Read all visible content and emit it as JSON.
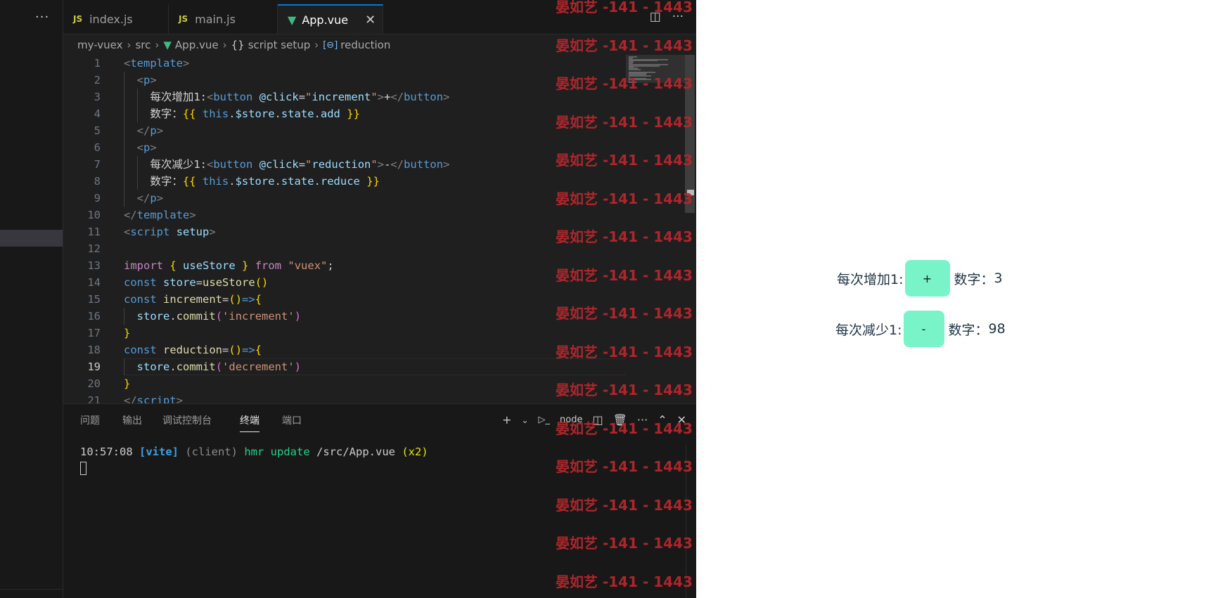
{
  "sidebar": {
    "more_label": "···"
  },
  "tabs": [
    {
      "label": "index.js",
      "icon": "js-icon",
      "icon_text": "JS"
    },
    {
      "label": "main.js",
      "icon": "js-icon",
      "icon_text": "JS"
    },
    {
      "label": "App.vue",
      "icon": "vue-icon",
      "close": "✕"
    }
  ],
  "breadcrumb": {
    "items": [
      "my-vuex",
      "src",
      "App.vue",
      "script setup",
      "reduction"
    ],
    "brace": "{}",
    "var_icon": "[⊖]"
  },
  "code": {
    "current_line": 19,
    "lines": [
      [
        [
          "t-punc",
          "<"
        ],
        [
          "t-tag",
          "template"
        ],
        [
          "t-punc",
          ">"
        ]
      ],
      [
        [
          "t-plain",
          "  "
        ],
        [
          "t-punc",
          "<"
        ],
        [
          "t-tag",
          "p"
        ],
        [
          "t-punc",
          ">"
        ]
      ],
      [
        [
          "t-plain",
          "    "
        ],
        [
          "t-text",
          "每次增加1:"
        ],
        [
          "t-punc",
          "<"
        ],
        [
          "t-tag",
          "button"
        ],
        [
          "t-plain",
          " "
        ],
        [
          "t-attr",
          "@click"
        ],
        [
          "t-text",
          "="
        ],
        [
          "t-str",
          "\""
        ],
        [
          "t-var",
          "increment"
        ],
        [
          "t-str",
          "\""
        ],
        [
          "t-punc",
          ">"
        ],
        [
          "t-text",
          "+"
        ],
        [
          "t-punc",
          "</"
        ],
        [
          "t-tag",
          "button"
        ],
        [
          "t-punc",
          ">"
        ]
      ],
      [
        [
          "t-plain",
          "    "
        ],
        [
          "t-text",
          "数字："
        ],
        [
          "t-br1",
          "{{"
        ],
        [
          "t-plain",
          " "
        ],
        [
          "t-kw",
          "this"
        ],
        [
          "t-plain",
          "."
        ],
        [
          "t-var",
          "$store"
        ],
        [
          "t-plain",
          "."
        ],
        [
          "t-var",
          "state"
        ],
        [
          "t-plain",
          "."
        ],
        [
          "t-var",
          "add"
        ],
        [
          "t-plain",
          " "
        ],
        [
          "t-br1",
          "}}"
        ]
      ],
      [
        [
          "t-plain",
          "  "
        ],
        [
          "t-punc",
          "</"
        ],
        [
          "t-tag",
          "p"
        ],
        [
          "t-punc",
          ">"
        ]
      ],
      [
        [
          "t-plain",
          "  "
        ],
        [
          "t-punc",
          "<"
        ],
        [
          "t-tag",
          "p"
        ],
        [
          "t-punc",
          ">"
        ]
      ],
      [
        [
          "t-plain",
          "    "
        ],
        [
          "t-text",
          "每次减少1:"
        ],
        [
          "t-punc",
          "<"
        ],
        [
          "t-tag",
          "button"
        ],
        [
          "t-plain",
          " "
        ],
        [
          "t-attr",
          "@click"
        ],
        [
          "t-text",
          "="
        ],
        [
          "t-str",
          "\""
        ],
        [
          "t-var",
          "reduction"
        ],
        [
          "t-str",
          "\""
        ],
        [
          "t-punc",
          ">"
        ],
        [
          "t-text",
          "-"
        ],
        [
          "t-punc",
          "</"
        ],
        [
          "t-tag",
          "button"
        ],
        [
          "t-punc",
          ">"
        ]
      ],
      [
        [
          "t-plain",
          "    "
        ],
        [
          "t-text",
          "数字："
        ],
        [
          "t-br1",
          "{{"
        ],
        [
          "t-plain",
          " "
        ],
        [
          "t-kw",
          "this"
        ],
        [
          "t-plain",
          "."
        ],
        [
          "t-var",
          "$store"
        ],
        [
          "t-plain",
          "."
        ],
        [
          "t-var",
          "state"
        ],
        [
          "t-plain",
          "."
        ],
        [
          "t-var",
          "reduce"
        ],
        [
          "t-plain",
          " "
        ],
        [
          "t-br1",
          "}}"
        ]
      ],
      [
        [
          "t-plain",
          "  "
        ],
        [
          "t-punc",
          "</"
        ],
        [
          "t-tag",
          "p"
        ],
        [
          "t-punc",
          ">"
        ]
      ],
      [
        [
          "t-punc",
          "</"
        ],
        [
          "t-tag",
          "template"
        ],
        [
          "t-punc",
          ">"
        ]
      ],
      [
        [
          "t-punc",
          "<"
        ],
        [
          "t-tag",
          "script"
        ],
        [
          "t-plain",
          " "
        ],
        [
          "t-attr",
          "setup"
        ],
        [
          "t-punc",
          ">"
        ]
      ],
      [],
      [
        [
          "t-kw2",
          "import"
        ],
        [
          "t-plain",
          " "
        ],
        [
          "t-br1",
          "{"
        ],
        [
          "t-plain",
          " "
        ],
        [
          "t-var",
          "useStore"
        ],
        [
          "t-plain",
          " "
        ],
        [
          "t-br1",
          "}"
        ],
        [
          "t-plain",
          " "
        ],
        [
          "t-kw2",
          "from"
        ],
        [
          "t-plain",
          " "
        ],
        [
          "t-str",
          "\"vuex\""
        ],
        [
          "t-plain",
          ";"
        ]
      ],
      [
        [
          "t-kw",
          "const"
        ],
        [
          "t-plain",
          " "
        ],
        [
          "t-var",
          "store"
        ],
        [
          "t-plain",
          "="
        ],
        [
          "t-fn",
          "useStore"
        ],
        [
          "t-br1",
          "()"
        ]
      ],
      [
        [
          "t-kw",
          "const"
        ],
        [
          "t-plain",
          " "
        ],
        [
          "t-fn",
          "increment"
        ],
        [
          "t-plain",
          "="
        ],
        [
          "t-br1",
          "()"
        ],
        [
          "t-kw",
          "=>"
        ],
        [
          "t-br1",
          "{"
        ]
      ],
      [
        [
          "t-plain",
          "  "
        ],
        [
          "t-var",
          "store"
        ],
        [
          "t-plain",
          "."
        ],
        [
          "t-fn",
          "commit"
        ],
        [
          "t-br2",
          "("
        ],
        [
          "t-str",
          "'increment'"
        ],
        [
          "t-br2",
          ")"
        ]
      ],
      [
        [
          "t-br1",
          "}"
        ]
      ],
      [
        [
          "t-kw",
          "const"
        ],
        [
          "t-plain",
          " "
        ],
        [
          "t-fn",
          "reduction"
        ],
        [
          "t-plain",
          "="
        ],
        [
          "t-br1",
          "()"
        ],
        [
          "t-kw",
          "=>"
        ],
        [
          "t-br1",
          "{"
        ]
      ],
      [
        [
          "t-plain",
          "  "
        ],
        [
          "t-var",
          "store"
        ],
        [
          "t-plain",
          "."
        ],
        [
          "t-fn",
          "commit"
        ],
        [
          "t-br2",
          "("
        ],
        [
          "t-str",
          "'decrement'"
        ],
        [
          "t-br2",
          ")"
        ]
      ],
      [
        [
          "t-br1",
          "}"
        ]
      ],
      [
        [
          "t-punc",
          "</"
        ],
        [
          "t-tag",
          "script"
        ],
        [
          "t-punc",
          ">"
        ]
      ]
    ]
  },
  "panel": {
    "tabs": [
      "问题",
      "输出",
      "调试控制台",
      "终端",
      "端口"
    ],
    "active_tab": "终端",
    "shell_label": "node",
    "terminal": {
      "time": "10:57:08",
      "tag": "[vite]",
      "client": "(client)",
      "action": "hmr update",
      "path": "/src/App.vue",
      "count": "(x2)"
    }
  },
  "watermark": {
    "text": "晏如艺 -141 - 1443"
  },
  "preview": {
    "row1": {
      "label": "每次增加1:",
      "button": "+",
      "number_label": "数字：",
      "number": "3"
    },
    "row2": {
      "label": "每次减少1:",
      "button": "-",
      "number_label": "数字：",
      "number": "98"
    },
    "button_color": "#79f4c9"
  }
}
